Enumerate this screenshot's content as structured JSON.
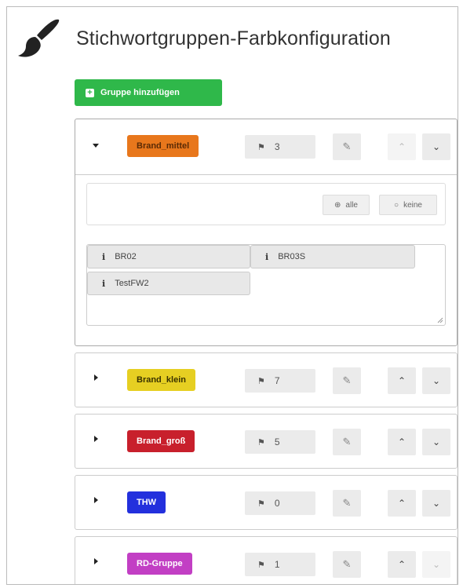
{
  "page": {
    "title": "Stichwortgruppen-Farbkonfiguration",
    "icon": "paintbrush-icon"
  },
  "toolbar": {
    "add_group_label": "Gruppe hinzufügen",
    "add_icon": "plus-square-icon"
  },
  "colors": {
    "add_button": "#2fb84a",
    "brand_mittel": "#e8771c",
    "brand_klein": "#e6cf22",
    "brand_gross": "#c8202c",
    "thw": "#2330dd",
    "rd_gruppe": "#c23fc4"
  },
  "groups": [
    {
      "name": "Brand_mittel",
      "count": "3",
      "expanded": true,
      "up_disabled": true,
      "down_disabled": false,
      "color": "#e8771c",
      "text_color": "#5a2a05"
    },
    {
      "name": "Brand_klein",
      "count": "7",
      "expanded": false,
      "up_disabled": false,
      "down_disabled": false,
      "color": "#e6cf22",
      "text_color": "#3a3300"
    },
    {
      "name": "Brand_groß",
      "count": "5",
      "expanded": false,
      "up_disabled": false,
      "down_disabled": false,
      "color": "#c8202c",
      "text_color": "#ffffff"
    },
    {
      "name": "THW",
      "count": "0",
      "expanded": false,
      "up_disabled": false,
      "down_disabled": false,
      "color": "#2330dd",
      "text_color": "#ffffff"
    },
    {
      "name": "RD-Gruppe",
      "count": "1",
      "expanded": false,
      "up_disabled": false,
      "down_disabled": true,
      "color": "#c23fc4",
      "text_color": "#ffffff"
    }
  ],
  "expanded_group": {
    "select_all_label": "alle",
    "select_none_label": "keine",
    "tags": [
      "BR02",
      "BR03S",
      "TestFW2"
    ]
  }
}
